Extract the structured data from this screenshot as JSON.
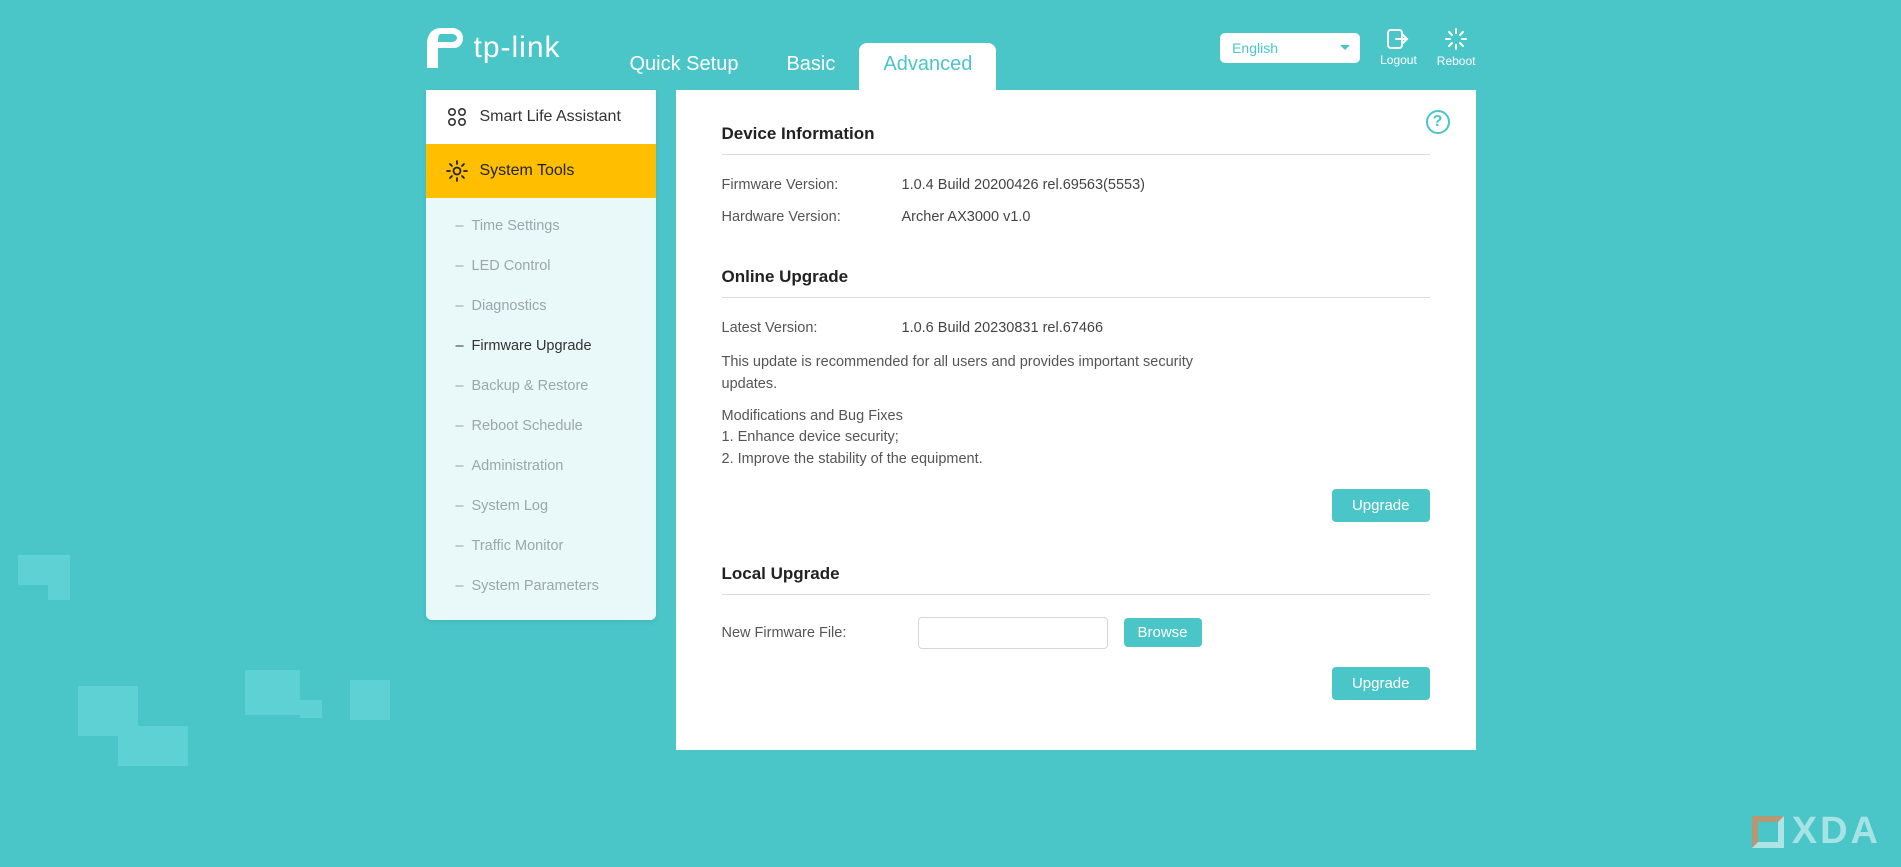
{
  "brand": "tp-link",
  "tabs": {
    "quick_setup": "Quick Setup",
    "basic": "Basic",
    "advanced": "Advanced"
  },
  "header": {
    "language": "English",
    "logout": "Logout",
    "reboot": "Reboot"
  },
  "sidebar": {
    "smart_life": "Smart Life Assistant",
    "system_tools": "System Tools",
    "items": [
      "Time Settings",
      "LED Control",
      "Diagnostics",
      "Firmware Upgrade",
      "Backup & Restore",
      "Reboot Schedule",
      "Administration",
      "System Log",
      "Traffic Monitor",
      "System Parameters"
    ]
  },
  "device_info": {
    "title": "Device Information",
    "firmware_label": "Firmware Version:",
    "firmware_value": "1.0.4 Build 20200426 rel.69563(5553)",
    "hardware_label": "Hardware Version:",
    "hardware_value": "Archer AX3000 v1.0"
  },
  "online_upgrade": {
    "title": "Online Upgrade",
    "latest_label": "Latest Version:",
    "latest_value": "1.0.6 Build 20230831 rel.67466",
    "desc": "This update is recommended for all users and provides important security updates.",
    "mods_heading": "Modifications and Bug Fixes",
    "mod1": "1. Enhance device security;",
    "mod2": "2. Improve the stability of the equipment.",
    "upgrade_btn": "Upgrade"
  },
  "local_upgrade": {
    "title": "Local Upgrade",
    "file_label": "New Firmware File:",
    "browse_btn": "Browse",
    "upgrade_btn": "Upgrade"
  },
  "watermark": "XDA"
}
